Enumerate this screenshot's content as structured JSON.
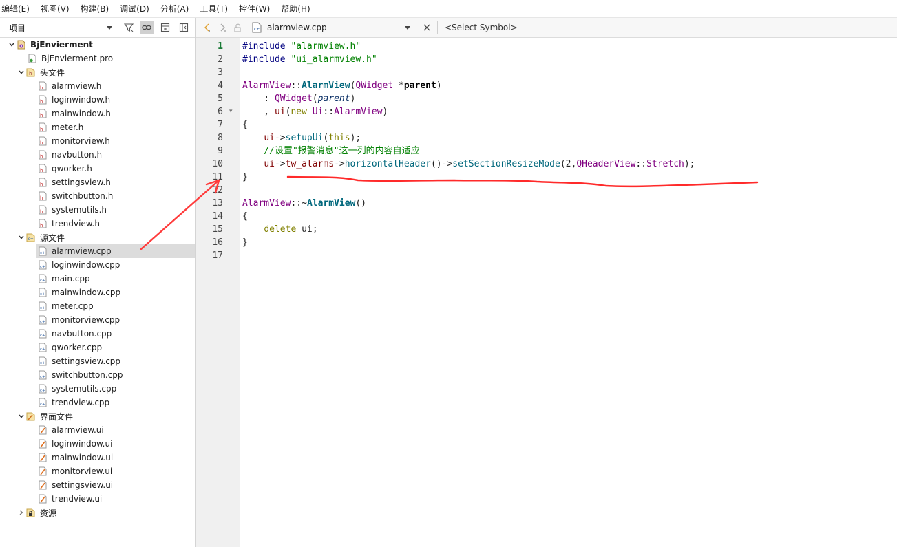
{
  "menu": [
    "编辑(E)",
    "视图(V)",
    "构建(B)",
    "调试(D)",
    "分析(A)",
    "工具(T)",
    "控件(W)",
    "帮助(H)"
  ],
  "left_panel": {
    "combo_label": "项目",
    "tree": {
      "project": "BjEnvierment",
      "pro_file": "BjEnvierment.pro",
      "headers_label": "头文件",
      "headers": [
        "alarmview.h",
        "loginwindow.h",
        "mainwindow.h",
        "meter.h",
        "monitorview.h",
        "navbutton.h",
        "qworker.h",
        "settingsview.h",
        "switchbutton.h",
        "systemutils.h",
        "trendview.h"
      ],
      "sources_label": "源文件",
      "sources": [
        "alarmview.cpp",
        "loginwindow.cpp",
        "main.cpp",
        "mainwindow.cpp",
        "meter.cpp",
        "monitorview.cpp",
        "navbutton.cpp",
        "qworker.cpp",
        "settingsview.cpp",
        "switchbutton.cpp",
        "systemutils.cpp",
        "trendview.cpp"
      ],
      "forms_label": "界面文件",
      "forms": [
        "alarmview.ui",
        "loginwindow.ui",
        "mainwindow.ui",
        "monitorview.ui",
        "settingsview.ui",
        "trendview.ui"
      ],
      "resources_label": "资源",
      "selected": "alarmview.cpp"
    }
  },
  "editor": {
    "file_name": "alarmview.cpp",
    "symbol_placeholder": "<Select Symbol>",
    "current_line": 1,
    "line_numbers": [
      "1",
      "2",
      "3",
      "4",
      "5",
      "6",
      "7",
      "8",
      "9",
      "10",
      "11",
      "12",
      "13",
      "14",
      "15",
      "16",
      "17"
    ],
    "code": {
      "l1_a": "#include ",
      "l1_b": "\"alarmview.h\"",
      "l2_a": "#include ",
      "l2_b": "\"ui_alarmview.h\"",
      "l4_a": "AlarmView",
      "l4_b": "::",
      "l4_c": "AlarmView",
      "l4_d": "(",
      "l4_e": "QWidget",
      "l4_f": " *",
      "l4_g": "parent",
      "l4_h": ")",
      "l5_a": "    : ",
      "l5_b": "QWidget",
      "l5_c": "(",
      "l5_d": "parent",
      "l5_e": ")",
      "l6_a": "    , ",
      "l6_b": "ui",
      "l6_c": "(",
      "l6_d": "new",
      "l6_e": " Ui",
      "l6_f": "::",
      "l6_g": "AlarmView",
      "l6_h": ")",
      "l7": "{",
      "l8_a": "    ",
      "l8_b": "ui",
      "l8_c": "->",
      "l8_d": "setupUi",
      "l8_e": "(",
      "l8_f": "this",
      "l8_g": ");",
      "l9": "    //设置\"报警消息\"这一列的内容自适应",
      "l10_a": "    ",
      "l10_b": "ui",
      "l10_c": "->",
      "l10_d": "tw_alarms",
      "l10_e": "->",
      "l10_f": "horizontalHeader",
      "l10_g": "()->",
      "l10_h": "setSectionResizeMode",
      "l10_i": "(2,",
      "l10_j": "QHeaderView",
      "l10_k": "::",
      "l10_l": "Stretch",
      "l10_m": ");",
      "l11": "}",
      "l13_a": "AlarmView",
      "l13_b": "::~",
      "l13_c": "AlarmView",
      "l13_d": "()",
      "l14": "{",
      "l15_a": "    ",
      "l15_b": "delete",
      "l15_c": " ui;",
      "l16": "}"
    }
  },
  "colors": {
    "annotation": "#ff2a2a",
    "current_line_number": "#1a7a36"
  }
}
